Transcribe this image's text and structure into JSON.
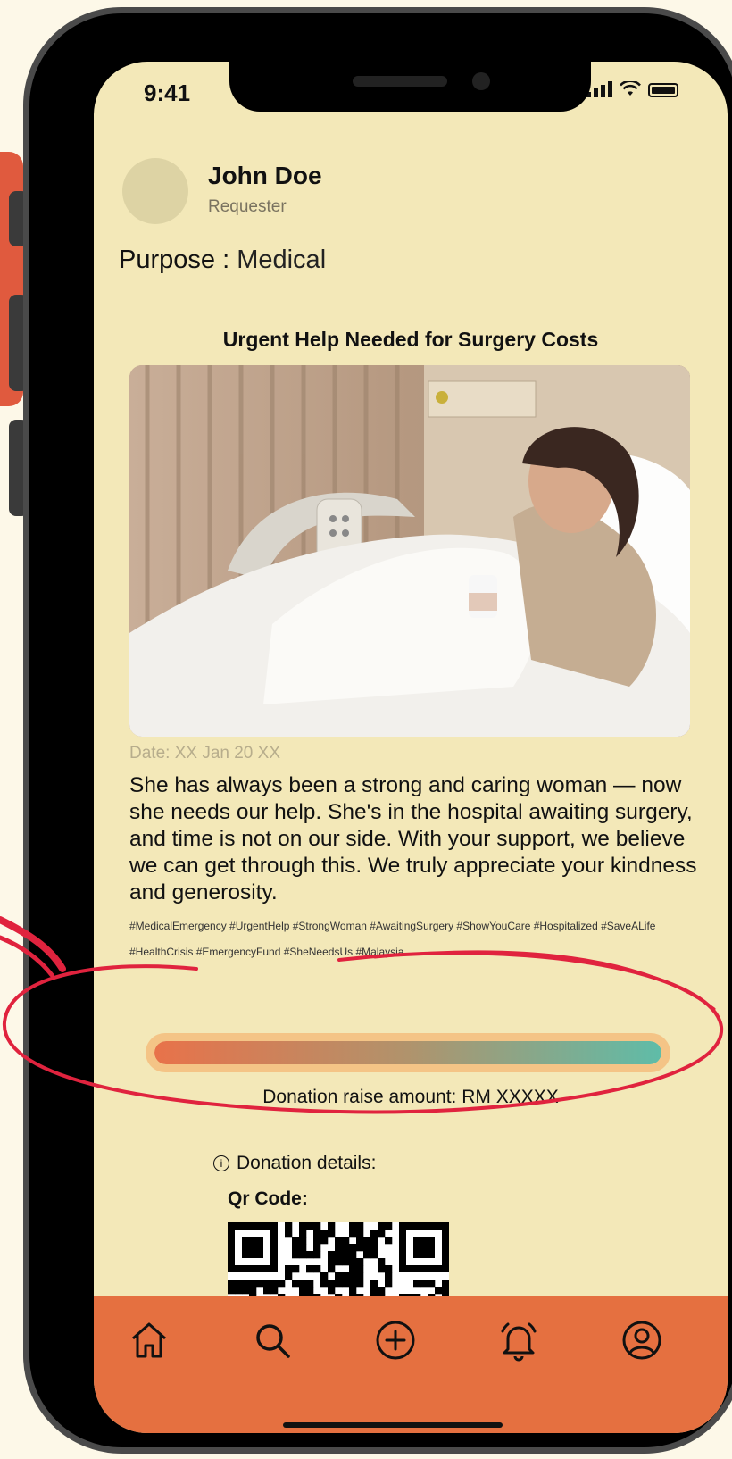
{
  "status_bar": {
    "time": "9:41"
  },
  "user": {
    "name": "John Doe",
    "role": "Requester"
  },
  "purpose": {
    "label": "Purpose :",
    "value": "Medical"
  },
  "post": {
    "title": "Urgent Help Needed for Surgery Costs",
    "date": "Date: XX Jan 20 XX",
    "description": "She has always been a strong and caring woman — now she needs our help. She's in the hospital awaiting surgery, and time is not on our side. With your support, we believe we can get through this. We truly appreciate your kindness and generosity.",
    "hashtags": "#MedicalEmergency #UrgentHelp #StrongWoman #AwaitingSurgery #ShowYouCare #Hospitalized #SaveALife #HealthCrisis #EmergencyFund #SheNeedsUs #Malaysia"
  },
  "donation": {
    "progress_percent": 100,
    "amount_text": "Donation raise amount: RM XXXXX",
    "details_label": "Donation details:",
    "qr_label": "Qr Code:"
  },
  "nav": {
    "items": [
      {
        "icon": "home-icon"
      },
      {
        "icon": "search-icon"
      },
      {
        "icon": "add-circle-icon"
      },
      {
        "icon": "bell-icon"
      },
      {
        "icon": "profile-icon"
      }
    ]
  },
  "colors": {
    "screen_bg": "#f3e8b8",
    "navbar": "#e57040",
    "progress_start": "#e8724a",
    "progress_end": "#5fbca8",
    "annotation": "#e0233e"
  }
}
